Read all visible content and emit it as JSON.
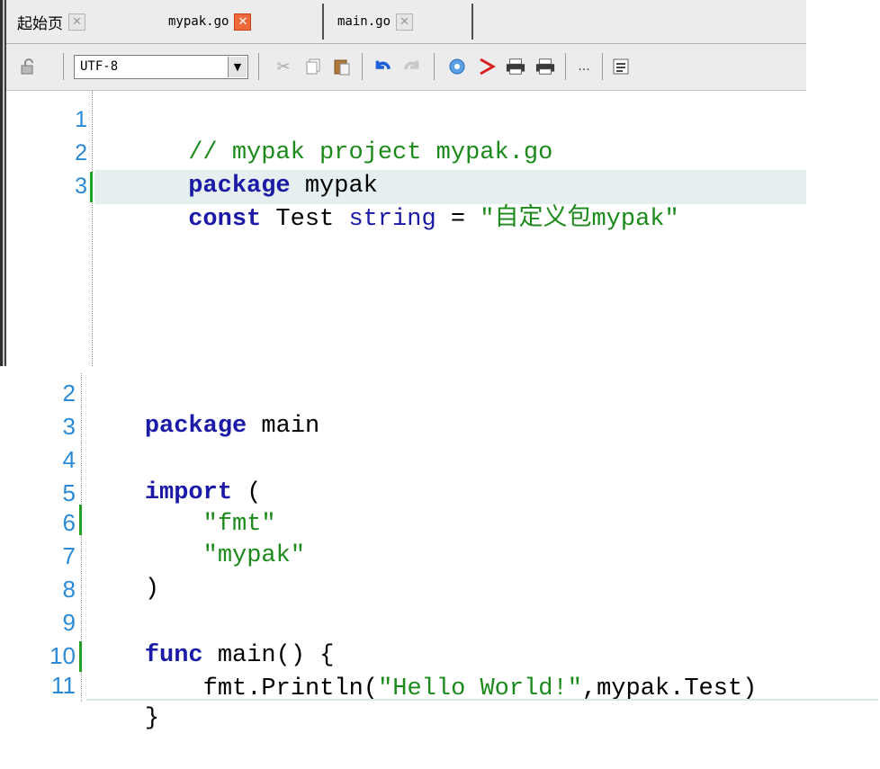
{
  "tabs": [
    {
      "label": "起始页",
      "close_icon": "close-icon",
      "active": false
    },
    {
      "label": "mypak.go",
      "close_icon": "close-icon",
      "active": true
    },
    {
      "label": "main.go",
      "close_icon": "close-icon",
      "active": false
    }
  ],
  "toolbar": {
    "lock_icon": "lock-icon",
    "encoding": "UTF-8",
    "icons": [
      "cut-icon",
      "copy-icon",
      "paste-icon",
      "undo-icon",
      "redo-icon",
      "globe-icon",
      "pdf-icon",
      "print-preview-icon",
      "print-icon",
      "more-icon",
      "outline-icon"
    ],
    "more_label": "..."
  },
  "editor_top": {
    "lines": [
      {
        "num": "1",
        "segments": [
          {
            "t": "// mypak project mypak.go",
            "c": "cm"
          }
        ]
      },
      {
        "num": "2",
        "segments": [
          {
            "t": "package",
            "c": "kw"
          },
          {
            "t": " mypak",
            "c": "plain"
          }
        ]
      },
      {
        "num": "3",
        "segments": [
          {
            "t": "const",
            "c": "kw"
          },
          {
            "t": " Test ",
            "c": "plain"
          },
          {
            "t": "string",
            "c": "kw-light"
          },
          {
            "t": " = ",
            "c": "plain"
          },
          {
            "t": "\"自定义包mypak\"",
            "c": "st"
          }
        ],
        "highlighted": true,
        "modified": true
      }
    ]
  },
  "editor_bottom": {
    "lines": [
      {
        "num": "2",
        "segments": [
          {
            "t": "package",
            "c": "kw"
          },
          {
            "t": " main",
            "c": "plain"
          }
        ]
      },
      {
        "num": "3",
        "segments": []
      },
      {
        "num": "4",
        "segments": [
          {
            "t": "import",
            "c": "kw"
          },
          {
            "t": " (",
            "c": "plain"
          }
        ]
      },
      {
        "num": "5",
        "segments": [
          {
            "t": "    \"fmt\"",
            "c": "st"
          }
        ]
      },
      {
        "num": "6",
        "segments": [
          {
            "t": "    \"mypak\"",
            "c": "st"
          }
        ],
        "modified": true
      },
      {
        "num": "7",
        "segments": [
          {
            "t": ")",
            "c": "plain"
          }
        ]
      },
      {
        "num": "8",
        "segments": []
      },
      {
        "num": "9",
        "segments": [
          {
            "t": "func",
            "c": "kw"
          },
          {
            "t": " main() {",
            "c": "plain"
          }
        ]
      },
      {
        "num": "10",
        "segments": [
          {
            "t": "    fmt.Println(",
            "c": "plain"
          },
          {
            "t": "\"Hello World!\"",
            "c": "st"
          },
          {
            "t": ",mypak.Test)",
            "c": "plain"
          }
        ],
        "modified": true
      },
      {
        "num": "11",
        "segments": [
          {
            "t": "}",
            "c": "plain"
          }
        ]
      }
    ]
  }
}
